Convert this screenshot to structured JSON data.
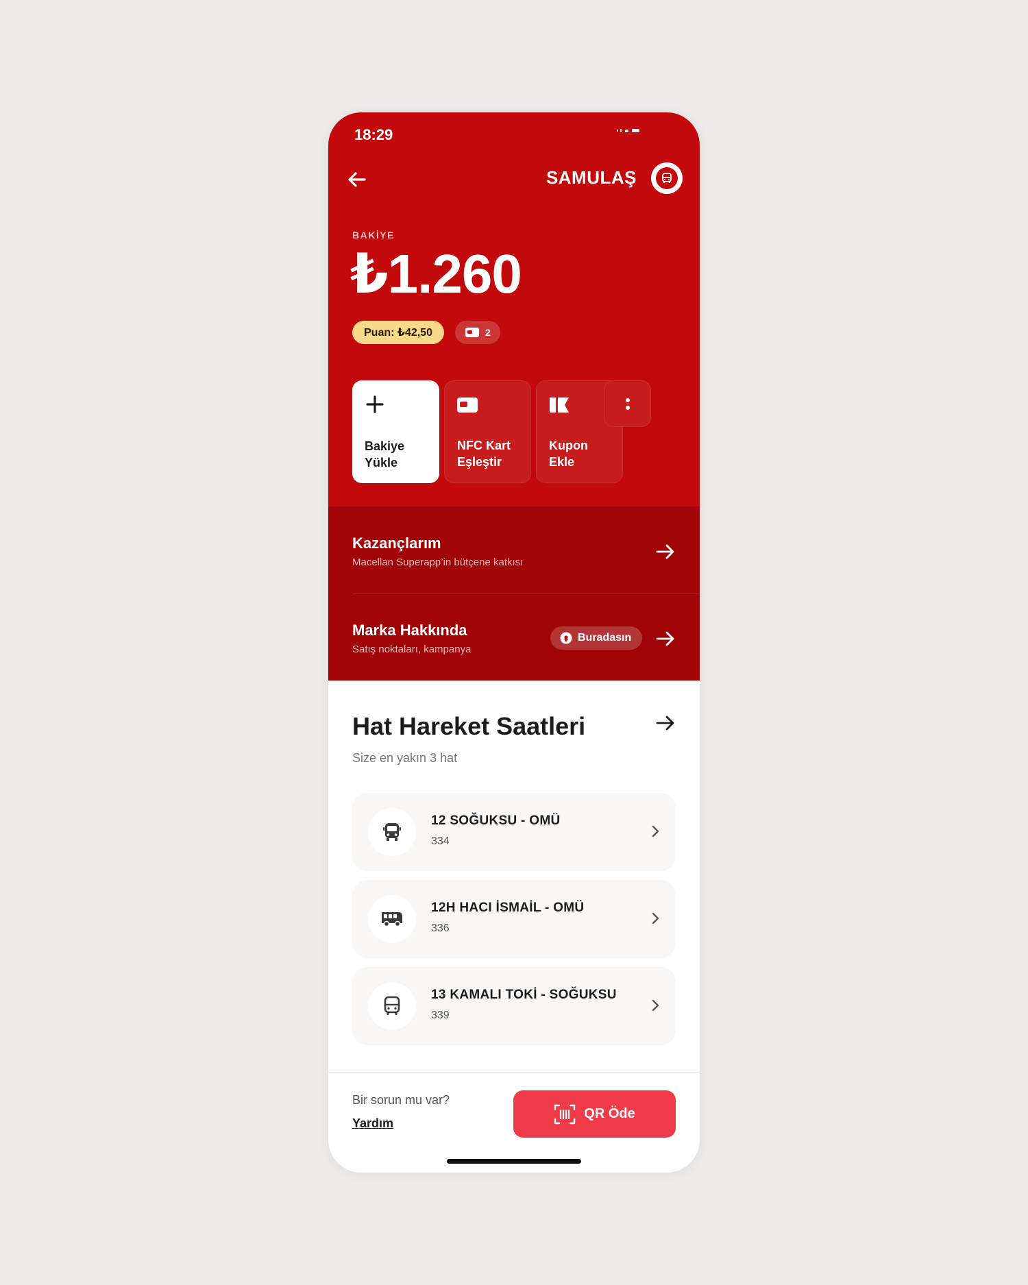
{
  "status": {
    "time": "18:29"
  },
  "header": {
    "brand": "SAMULAŞ"
  },
  "balance": {
    "label": "BAKİYE",
    "amount": "₺1.260",
    "points": "Puan: ₺42,50",
    "card_count": "2"
  },
  "actions": [
    {
      "label": "Bakiye\nYükle",
      "icon": "plus-icon"
    },
    {
      "label": "NFC Kart\nEşleştir",
      "icon": "nfc-card-icon"
    },
    {
      "label": "Kupon\nEkle",
      "icon": "coupon-icon"
    }
  ],
  "rows": [
    {
      "title": "Kazançlarım",
      "subtitle": "Macellan Superapp’in bütçene katkısı"
    },
    {
      "title": "Marka Hakkında",
      "subtitle": "Satış noktaları, kampanya",
      "badge": "Buradasın"
    }
  ],
  "schedule": {
    "title": "Hat Hareket Saatleri",
    "subtitle": "Size en yakın 3 hat",
    "lines": [
      {
        "name": "12 SOĞUKSU - OMÜ",
        "code": "334",
        "icon": "bus-front-icon"
      },
      {
        "name": "12H HACI İSMAİL - OMÜ",
        "code": "336",
        "icon": "bus-side-icon"
      },
      {
        "name": "13 KAMALI TOKİ - SOĞUKSU",
        "code": "339",
        "icon": "bus-icon"
      }
    ]
  },
  "footer": {
    "question": "Bir sorun mu var?",
    "help": "Yardım",
    "qr_button": "QR Öde"
  },
  "colors": {
    "brand_red": "#c20a0c",
    "dark_red": "#a00406",
    "qr_button": "#ef3a4a",
    "points_badge": "#fbd98a"
  }
}
